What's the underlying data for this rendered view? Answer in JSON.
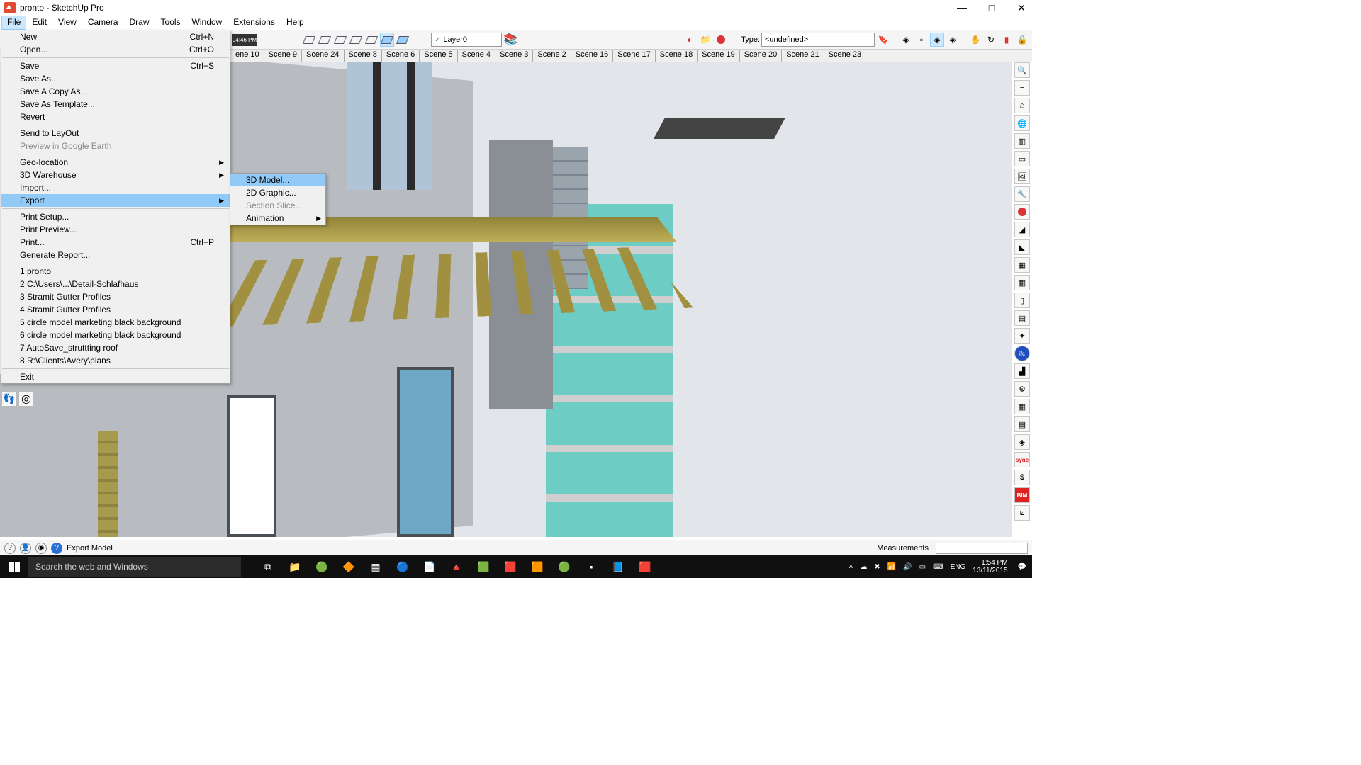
{
  "window": {
    "title": "pronto - SketchUp Pro"
  },
  "menubar": [
    "File",
    "Edit",
    "View",
    "Camera",
    "Draw",
    "Tools",
    "Window",
    "Extensions",
    "Help"
  ],
  "toolbar": {
    "layer": "Layer0",
    "type_label": "Type:",
    "type_value": "<undefined>",
    "time": "04:46 PM"
  },
  "scenes": [
    "ene 10",
    "Scene 9",
    "Scene 24",
    "Scene 8",
    "Scene 6",
    "Scene 5",
    "Scene 4",
    "Scene 3",
    "Scene 2",
    "Scene 16",
    "Scene 17",
    "Scene 18",
    "Scene 19",
    "Scene 20",
    "Scene 21",
    "Scene 23"
  ],
  "file_menu": {
    "groups": [
      [
        {
          "label": "New",
          "shortcut": "Ctrl+N"
        },
        {
          "label": "Open...",
          "shortcut": "Ctrl+O"
        }
      ],
      [
        {
          "label": "Save",
          "shortcut": "Ctrl+S"
        },
        {
          "label": "Save As..."
        },
        {
          "label": "Save A Copy As..."
        },
        {
          "label": "Save As Template..."
        },
        {
          "label": "Revert"
        }
      ],
      [
        {
          "label": "Send to LayOut"
        },
        {
          "label": "Preview in Google Earth",
          "disabled": true
        }
      ],
      [
        {
          "label": "Geo-location",
          "submenu": true
        },
        {
          "label": "3D Warehouse",
          "submenu": true
        },
        {
          "label": "Import..."
        },
        {
          "label": "Export",
          "submenu": true,
          "highlight": true
        }
      ],
      [
        {
          "label": "Print Setup..."
        },
        {
          "label": "Print Preview..."
        },
        {
          "label": "Print...",
          "shortcut": "Ctrl+P"
        },
        {
          "label": "Generate Report..."
        }
      ],
      [
        {
          "label": "1 pronto"
        },
        {
          "label": "2 C:\\Users\\...\\Detail-Schlafhaus"
        },
        {
          "label": "3 Stramit Gutter Profiles"
        },
        {
          "label": "4 Stramit Gutter Profiles"
        },
        {
          "label": "5 circle model marketing black background"
        },
        {
          "label": "6 circle model marketing black background"
        },
        {
          "label": "7 AutoSave_struttting roof"
        },
        {
          "label": "8 R:\\Clients\\Avery\\plans"
        }
      ],
      [
        {
          "label": "Exit"
        }
      ]
    ]
  },
  "export_submenu": [
    {
      "label": "3D Model...",
      "highlight": true
    },
    {
      "label": "2D Graphic..."
    },
    {
      "label": "Section Slice...",
      "disabled": true
    },
    {
      "label": "Animation",
      "submenu": true
    }
  ],
  "status": {
    "hint": "Export Model",
    "measure_label": "Measurements"
  },
  "taskbar": {
    "search_placeholder": "Search the web and Windows",
    "lang": "ENG",
    "clock_time": "1:54 PM",
    "clock_date": "13/11/2015"
  }
}
